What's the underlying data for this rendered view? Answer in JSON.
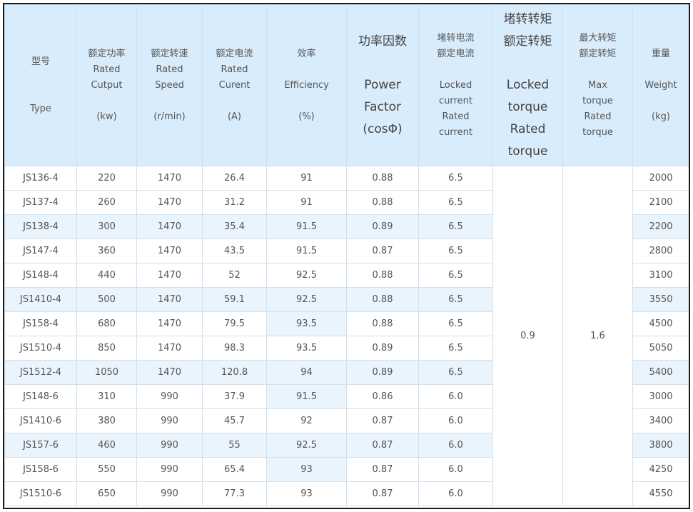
{
  "headers": [
    {
      "zh": "型号",
      "en": [
        "Type"
      ]
    },
    {
      "zh": "额定功率",
      "en": [
        "Rated",
        "Cutput"
      ],
      "unit": "(kw)"
    },
    {
      "zh": "额定转速",
      "en": [
        "Rated",
        "Speed"
      ],
      "unit": "(r/min)"
    },
    {
      "zh": "额定电流",
      "en": [
        "Rated",
        "Curent"
      ],
      "unit": "(A)"
    },
    {
      "zh": "效率",
      "en": [
        "Efficiency"
      ],
      "unit": "(%)"
    },
    {
      "zh": "功率因数",
      "en": [
        "Power",
        "Factor",
        "(cosΦ)"
      ]
    },
    {
      "zh": [
        "堵转电流",
        "额定电流"
      ],
      "en": [
        "Locked",
        "current",
        "Rated",
        "current"
      ]
    },
    {
      "zh": [
        "堵转转矩",
        "额定转矩"
      ],
      "en": [
        "Locked",
        "torque",
        "Rated",
        "torque"
      ]
    },
    {
      "zh": [
        "最大转矩",
        "额定转矩"
      ],
      "en": [
        "Max",
        "torque",
        "Rated",
        "torque"
      ]
    },
    {
      "zh": "重量",
      "en": [
        "Weight"
      ],
      "unit": "(kg)"
    }
  ],
  "merged": {
    "locked_torque_ratio": "0.9",
    "max_torque_ratio": "1.6"
  },
  "rows": [
    {
      "type": "JS136-4",
      "power": "220",
      "speed": "1470",
      "current": "26.4",
      "efficiency": "91",
      "pf": "0.88",
      "lc": "6.5",
      "weight": "2000"
    },
    {
      "type": "JS137-4",
      "power": "260",
      "speed": "1470",
      "current": "31.2",
      "efficiency": "91",
      "pf": "0.88",
      "lc": "6.5",
      "weight": "2100"
    },
    {
      "type": "JS138-4",
      "power": "300",
      "speed": "1470",
      "current": "35.4",
      "efficiency": "91.5",
      "pf": "0.89",
      "lc": "6.5",
      "weight": "2200"
    },
    {
      "type": "JS147-4",
      "power": "360",
      "speed": "1470",
      "current": "43.5",
      "efficiency": "91.5",
      "pf": "0.87",
      "lc": "6.5",
      "weight": "2800"
    },
    {
      "type": "JS148-4",
      "power": "440",
      "speed": "1470",
      "current": "52",
      "efficiency": "92.5",
      "pf": "0.88",
      "lc": "6.5",
      "weight": "3100"
    },
    {
      "type": "JS1410-4",
      "power": "500",
      "speed": "1470",
      "current": "59.1",
      "efficiency": "92.5",
      "pf": "0.88",
      "lc": "6.5",
      "weight": "3550"
    },
    {
      "type": "JS158-4",
      "power": "680",
      "speed": "1470",
      "current": "79.5",
      "efficiency": "93.5",
      "pf": "0.88",
      "lc": "6.5",
      "weight": "4500"
    },
    {
      "type": "JS1510-4",
      "power": "850",
      "speed": "1470",
      "current": "98.3",
      "efficiency": "93.5",
      "pf": "0.89",
      "lc": "6.5",
      "weight": "5050"
    },
    {
      "type": "JS1512-4",
      "power": "1050",
      "speed": "1470",
      "current": "120.8",
      "efficiency": "94",
      "pf": "0.89",
      "lc": "6.5",
      "weight": "5400"
    },
    {
      "type": "JS148-6",
      "power": "310",
      "speed": "990",
      "current": "37.9",
      "efficiency": "91.5",
      "pf": "0.86",
      "lc": "6.0",
      "weight": "3000"
    },
    {
      "type": "JS1410-6",
      "power": "380",
      "speed": "990",
      "current": "45.7",
      "efficiency": "92",
      "pf": "0.87",
      "lc": "6.0",
      "weight": "3400"
    },
    {
      "type": "JS157-6",
      "power": "460",
      "speed": "990",
      "current": "55",
      "efficiency": "92.5",
      "pf": "0.87",
      "lc": "6.0",
      "weight": "3800"
    },
    {
      "type": "JS158-6",
      "power": "550",
      "speed": "990",
      "current": "65.4",
      "efficiency": "93",
      "pf": "0.87",
      "lc": "6.0",
      "weight": "4250"
    },
    {
      "type": "JS1510-6",
      "power": "650",
      "speed": "990",
      "current": "77.3",
      "efficiency": "93",
      "pf": "0.87",
      "lc": "6.0",
      "weight": "4550"
    }
  ]
}
